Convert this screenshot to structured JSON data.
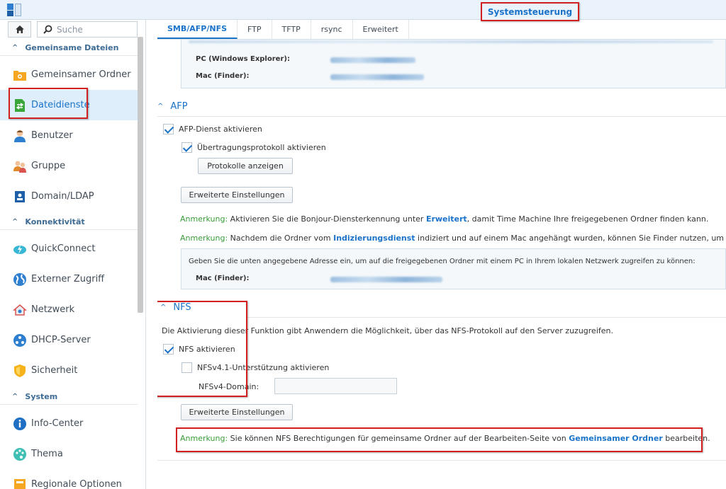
{
  "window": {
    "title": "Systemsteuerung"
  },
  "sidebar": {
    "search_placeholder": "Suche",
    "sections": [
      {
        "label": "Gemeinsame Dateien"
      },
      {
        "label": "Konnektivität"
      },
      {
        "label": "System"
      }
    ],
    "items": [
      {
        "label": "Gemeinsamer Ordner"
      },
      {
        "label": "Dateidienste"
      },
      {
        "label": "Benutzer"
      },
      {
        "label": "Gruppe"
      },
      {
        "label": "Domain/LDAP"
      },
      {
        "label": "QuickConnect"
      },
      {
        "label": "Externer Zugriff"
      },
      {
        "label": "Netzwerk"
      },
      {
        "label": "DHCP-Server"
      },
      {
        "label": "Sicherheit"
      },
      {
        "label": "Info-Center"
      },
      {
        "label": "Thema"
      },
      {
        "label": "Regionale Optionen"
      }
    ],
    "active_item": "Dateidienste"
  },
  "tabs": [
    {
      "label": "SMB/AFP/NFS"
    },
    {
      "label": "FTP"
    },
    {
      "label": "TFTP"
    },
    {
      "label": "rsync"
    },
    {
      "label": "Erweitert"
    }
  ],
  "smb": {
    "pc_label": "PC (Windows Explorer):",
    "mac_label": "Mac (Finder):"
  },
  "afp": {
    "title": "AFP",
    "enable_label": "AFP-Dienst aktivieren",
    "enable_checked": true,
    "transfer_label": "Übertragungsprotokoll aktivieren",
    "transfer_checked": true,
    "show_logs_button": "Protokolle anzeigen",
    "advanced_button": "Erweiterte Einstellungen",
    "note1_prefix": "Anmerkung:",
    "note1_text": " Aktivieren Sie die Bonjour-Diensterkennung unter ",
    "note1_link": "Erweitert",
    "note1_suffix": ", damit Time Machine Ihre freigegebenen Ordner finden kann.",
    "note2_prefix": "Anmerkung:",
    "note2_text": " Nachdem die Ordner vom ",
    "note2_link": "Indizierungsdienst",
    "note2_suffix": " indiziert und auf einem Mac angehängt wurden, können Sie Finder nutzen, um in de",
    "info_text": "Geben Sie die unten angegebene Adresse ein, um auf die freigegebenen Ordner mit einem PC in Ihrem lokalen Netzwerk zugreifen zu können:",
    "mac_label": "Mac (Finder):"
  },
  "nfs": {
    "title": "NFS",
    "description": "Die Aktivierung dieser Funktion gibt Anwendern die Möglichkeit, über das NFS-Protokoll auf den Server zuzugreifen.",
    "enable_label": "NFS aktivieren",
    "enable_checked": true,
    "v41_label": "NFSv4.1-Unterstützung aktivieren",
    "v41_checked": false,
    "domain_label": "NFSv4-Domain:",
    "domain_value": "",
    "advanced_button": "Erweiterte Einstellungen",
    "note_prefix": "Anmerkung:",
    "note_text": " Sie können NFS Berechtigungen für gemeinsame Ordner auf der Bearbeiten-Seite von ",
    "note_link": "Gemeinsamer Ordner",
    "note_suffix": " bearbeiten."
  },
  "colors": {
    "accent": "#1a73c9",
    "note_green": "#3a9c3a",
    "highlight_red": "#d21f1f"
  },
  "icons": {
    "home": "home-icon",
    "search": "search-icon",
    "chevron": "chevron-up-icon"
  }
}
